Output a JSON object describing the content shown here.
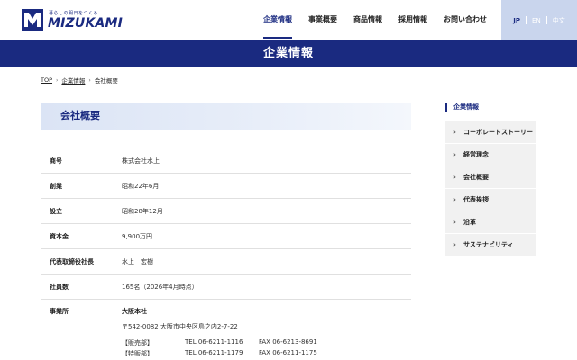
{
  "header": {
    "tagline": "暮らしの明日をつくる",
    "logo_text": "MIZUKAMI",
    "nav": [
      {
        "label": "企業情報",
        "active": true
      },
      {
        "label": "事業概要",
        "active": false
      },
      {
        "label": "商品情報",
        "active": false
      },
      {
        "label": "採用情報",
        "active": false
      },
      {
        "label": "お問い合わせ",
        "active": false
      }
    ],
    "languages": [
      "JP",
      "EN",
      "中文"
    ],
    "active_language": "JP"
  },
  "banner": {
    "title": "企業情報"
  },
  "breadcrumb": {
    "top": "TOP",
    "parent": "企業情報",
    "current": "会社概要"
  },
  "section": {
    "title": "会社概要"
  },
  "info_table": {
    "rows": [
      {
        "label": "商号",
        "value": "株式会社水上"
      },
      {
        "label": "創業",
        "value": "昭和22年6月"
      },
      {
        "label": "設立",
        "value": "昭和28年12月"
      },
      {
        "label": "資本金",
        "value": "9,900万円"
      },
      {
        "label": "代表取締役社長",
        "value": "水上　宏樹"
      },
      {
        "label": "社員数",
        "value": "165名（2026年4月時点）"
      }
    ],
    "office": {
      "label": "事業所",
      "name": "大阪本社",
      "address": "〒542-0082 大阪市中央区島之内2-7-22",
      "lines": [
        {
          "dept": "【販売部】",
          "tel": "TEL 06-6211-1116",
          "fax": "FAX 06-6213-8691"
        },
        {
          "dept": "【特販部】",
          "tel": "TEL 06-6211-1179",
          "fax": "FAX 06-6211-1175"
        }
      ]
    }
  },
  "sidebar": {
    "title": "企業情報",
    "items": [
      {
        "label": "コーポレートストーリー"
      },
      {
        "label": "経営理念"
      },
      {
        "label": "会社概要"
      },
      {
        "label": "代表挨拶"
      },
      {
        "label": "沿革"
      },
      {
        "label": "サステナビリティ"
      }
    ]
  },
  "colors": {
    "brand": "#1a2a80",
    "lang_bg": "#c9d5ed",
    "side_bg": "#f1f1f1"
  }
}
